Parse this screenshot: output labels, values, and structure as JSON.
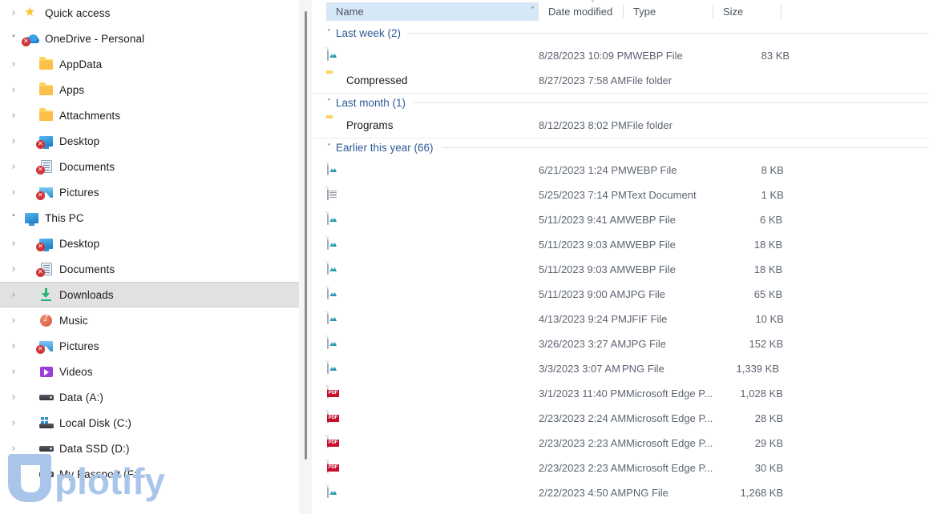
{
  "sidebar": {
    "items": [
      {
        "label": "Quick access",
        "icon": "star-icon",
        "chevron": "collapsed",
        "level": 0,
        "selected": false,
        "sync_error": false
      },
      {
        "label": "OneDrive - Personal",
        "icon": "onedrive-cloud-icon",
        "chevron": "expanded",
        "level": 0,
        "selected": false,
        "sync_error": true
      },
      {
        "label": "AppData",
        "icon": "folder-icon",
        "chevron": "collapsed",
        "level": 1,
        "selected": false,
        "sync_error": false
      },
      {
        "label": "Apps",
        "icon": "folder-icon",
        "chevron": "collapsed",
        "level": 1,
        "selected": false,
        "sync_error": false
      },
      {
        "label": "Attachments",
        "icon": "folder-icon",
        "chevron": "collapsed",
        "level": 1,
        "selected": false,
        "sync_error": false
      },
      {
        "label": "Desktop",
        "icon": "desktop-icon",
        "chevron": "collapsed",
        "level": 1,
        "selected": false,
        "sync_error": true
      },
      {
        "label": "Documents",
        "icon": "documents-icon",
        "chevron": "collapsed",
        "level": 1,
        "selected": false,
        "sync_error": true
      },
      {
        "label": "Pictures",
        "icon": "pictures-icon",
        "chevron": "collapsed",
        "level": 1,
        "selected": false,
        "sync_error": true
      },
      {
        "label": "This PC",
        "icon": "this-pc-icon",
        "chevron": "expanded",
        "level": 0,
        "selected": false,
        "sync_error": false
      },
      {
        "label": "Desktop",
        "icon": "desktop-icon",
        "chevron": "collapsed",
        "level": 1,
        "selected": false,
        "sync_error": true
      },
      {
        "label": "Documents",
        "icon": "documents-icon",
        "chevron": "collapsed",
        "level": 1,
        "selected": false,
        "sync_error": true
      },
      {
        "label": "Downloads",
        "icon": "downloads-icon",
        "chevron": "collapsed",
        "level": 1,
        "selected": true,
        "sync_error": false
      },
      {
        "label": "Music",
        "icon": "music-icon",
        "chevron": "collapsed",
        "level": 1,
        "selected": false,
        "sync_error": false
      },
      {
        "label": "Pictures",
        "icon": "pictures-icon",
        "chevron": "collapsed",
        "level": 1,
        "selected": false,
        "sync_error": true
      },
      {
        "label": "Videos",
        "icon": "videos-icon",
        "chevron": "collapsed",
        "level": 1,
        "selected": false,
        "sync_error": false
      },
      {
        "label": "Data (A:)",
        "icon": "drive-icon",
        "chevron": "collapsed",
        "level": 1,
        "selected": false,
        "sync_error": false
      },
      {
        "label": "Local Disk (C:)",
        "icon": "windows-drive-icon",
        "chevron": "collapsed",
        "level": 1,
        "selected": false,
        "sync_error": false
      },
      {
        "label": "Data SSD (D:)",
        "icon": "drive-icon",
        "chevron": "collapsed",
        "level": 1,
        "selected": false,
        "sync_error": false
      },
      {
        "label": "My Passport (F:)",
        "icon": "drive-icon",
        "chevron": "collapsed",
        "level": 1,
        "selected": false,
        "sync_error": false
      }
    ]
  },
  "columns": {
    "name": "Name",
    "date_modified": "Date modified",
    "type": "Type",
    "size": "Size",
    "sorted_by": "Date modified",
    "sort_direction": "descending",
    "active_column": "Name"
  },
  "groups": [
    {
      "title": "Last week (2)",
      "rows": [
        {
          "name": "",
          "icon": "image-file-icon",
          "date": "8/28/2023 10:09 PM",
          "type": "WEBP File",
          "size": "83 KB"
        },
        {
          "name": "Compressed",
          "icon": "folder-icon",
          "date": "8/27/2023 7:58 AM",
          "type": "File folder",
          "size": ""
        }
      ]
    },
    {
      "title": "Last month (1)",
      "rows": [
        {
          "name": "Programs",
          "icon": "folder-icon",
          "date": "8/12/2023 8:02 PM",
          "type": "File folder",
          "size": ""
        }
      ]
    },
    {
      "title": "Earlier this year (66)",
      "rows": [
        {
          "name": "",
          "icon": "image-file-icon",
          "date": "6/21/2023 1:24 PM",
          "type": "WEBP File",
          "size": "8 KB"
        },
        {
          "name": "",
          "icon": "text-file-icon",
          "date": "5/25/2023 7:14 PM",
          "type": "Text Document",
          "size": "1 KB"
        },
        {
          "name": "",
          "icon": "image-file-icon",
          "date": "5/11/2023 9:41 AM",
          "type": "WEBP File",
          "size": "6 KB"
        },
        {
          "name": "",
          "icon": "image-file-icon",
          "date": "5/11/2023 9:03 AM",
          "type": "WEBP File",
          "size": "18 KB"
        },
        {
          "name": "",
          "icon": "image-file-icon",
          "date": "5/11/2023 9:03 AM",
          "type": "WEBP File",
          "size": "18 KB"
        },
        {
          "name": "",
          "icon": "image-file-icon",
          "date": "5/11/2023 9:00 AM",
          "type": "JPG File",
          "size": "65 KB"
        },
        {
          "name": "",
          "icon": "image-file-icon",
          "date": "4/13/2023 9:24 PM",
          "type": "JFIF File",
          "size": "10 KB"
        },
        {
          "name": "",
          "icon": "image-file-icon",
          "date": "3/26/2023 3:27 AM",
          "type": "JPG File",
          "size": "152 KB"
        },
        {
          "name": "",
          "icon": "image-file-icon",
          "date": "3/3/2023 3:07 AM",
          "type": "PNG File",
          "size": "1,339 KB"
        },
        {
          "name": "",
          "icon": "pdf-file-icon",
          "date": "3/1/2023 11:40 PM",
          "type": "Microsoft Edge P...",
          "size": "1,028 KB"
        },
        {
          "name": "",
          "icon": "pdf-file-icon",
          "date": "2/23/2023 2:24 AM",
          "type": "Microsoft Edge P...",
          "size": "28 KB"
        },
        {
          "name": "",
          "icon": "pdf-file-icon",
          "date": "2/23/2023 2:23 AM",
          "type": "Microsoft Edge P...",
          "size": "29 KB"
        },
        {
          "name": "",
          "icon": "pdf-file-icon",
          "date": "2/23/2023 2:23 AM",
          "type": "Microsoft Edge P...",
          "size": "30 KB"
        },
        {
          "name": "",
          "icon": "image-file-icon",
          "date": "2/22/2023 4:50 AM",
          "type": "PNG File",
          "size": "1,268 KB"
        }
      ]
    }
  ],
  "watermark": {
    "text": "plotify",
    "logo": "U",
    "color": "#a9c6ea"
  },
  "colors": {
    "header_active": "#d6e8f7",
    "group_title": "#2c5a96",
    "selection": "#e1e1e1",
    "body_text": "#1b1b1b",
    "secondary_text": "#5c6471"
  }
}
